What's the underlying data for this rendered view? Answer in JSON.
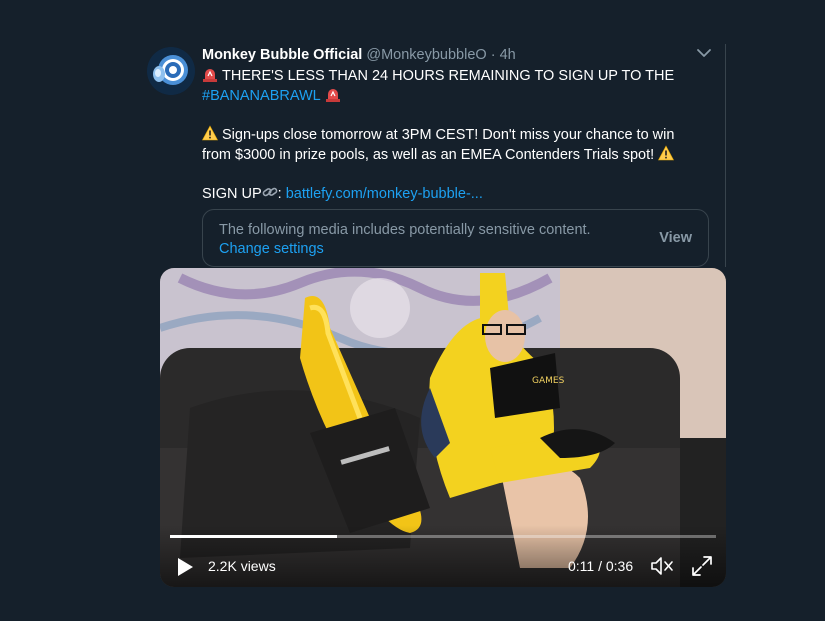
{
  "tweet": {
    "display_name": "Monkey Bubble Official",
    "handle": "@MonkeybubbleO",
    "separator": "·",
    "time": "4h",
    "line1": "THERE'S LESS THAN 24 HOURS REMAINING TO SIGN UP TO THE",
    "hashtag": "#BANANABRAWL",
    "line2": "Sign-ups close tomorrow at 3PM CEST! Don't miss your chance to win from $3000 in prize pools, as well as an EMEA Contenders Trials spot!",
    "signup_label": "SIGN UP",
    "signup_colon": ":",
    "signup_link": "battlefy.com/monkey-bubble-...",
    "icons": {
      "siren": "rotating-light-icon",
      "warning": "warning-icon",
      "link": "link-icon",
      "caret": "chevron-down-icon"
    }
  },
  "sensitive_notice": {
    "message": "The following media includes potentially sensitive content.",
    "change_settings": "Change settings",
    "view_button": "View"
  },
  "video": {
    "views": "2.2K views",
    "time": "0:11 / 0:36",
    "progress": 0.305
  },
  "colors": {
    "background": "#15202b",
    "border": "#38444d",
    "secondary_text": "#8899a6",
    "link": "#1da1f2"
  }
}
